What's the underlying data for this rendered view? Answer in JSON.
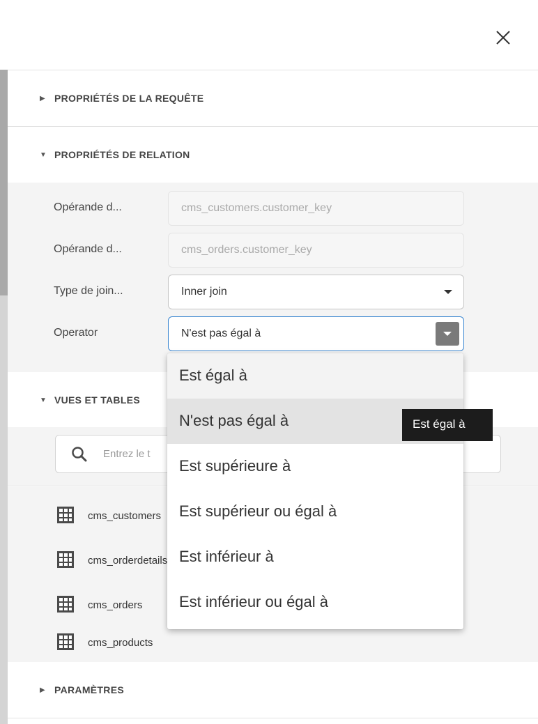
{
  "close_icon": "close-icon",
  "sections": {
    "query_properties": "PROPRIÉTÉS DE LA REQUÊTE",
    "relation_properties": "PROPRIÉTÉS DE RELATION",
    "views_tables": "VUES ET TABLES",
    "parameters": "PARAMÈTRES"
  },
  "arrows": {
    "collapsed": "▶",
    "expanded": "▼"
  },
  "relation": {
    "left_operand_label": "Opérande d...",
    "left_operand_value": "cms_customers.customer_key",
    "right_operand_label": "Opérande d...",
    "right_operand_value": "cms_orders.customer_key",
    "join_type_label": "Type de join...",
    "join_type_value": "Inner join",
    "operator_label": "Operator",
    "operator_value": "N'est pas égal à"
  },
  "search": {
    "placeholder": "Entrez le t",
    "icon": "search-icon"
  },
  "tables": [
    "cms_customers",
    "cms_orderdetails",
    "cms_orders",
    "cms_products"
  ],
  "operator_options": [
    "Est égal à",
    "N'est pas égal à",
    "Est supérieure à",
    "Est supérieur ou égal à",
    "Est inférieur à",
    "Est inférieur ou égal à"
  ],
  "tooltip": "Est égal à",
  "colors": {
    "accent": "#3a86d1",
    "table_icon": "#4a4a4a",
    "tooltip_bg": "#1c1c1c"
  }
}
